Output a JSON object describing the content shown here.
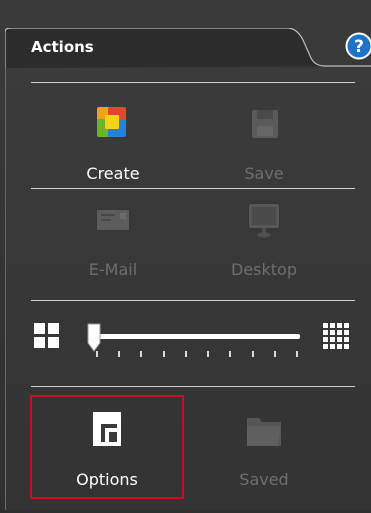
{
  "panel": {
    "title": "Actions"
  },
  "actions": {
    "create_label": "Create",
    "save_label": "Save",
    "email_label": "E-Mail",
    "desktop_label": "Desktop",
    "options_label": "Options",
    "saved_label": "Saved"
  },
  "zoom_slider": {
    "value": 0.0,
    "tick_count": 10
  },
  "colors": {
    "enabled_text": "#ffffff",
    "disabled_text": "#6e6e6e",
    "highlight_border": "#c5121a"
  }
}
